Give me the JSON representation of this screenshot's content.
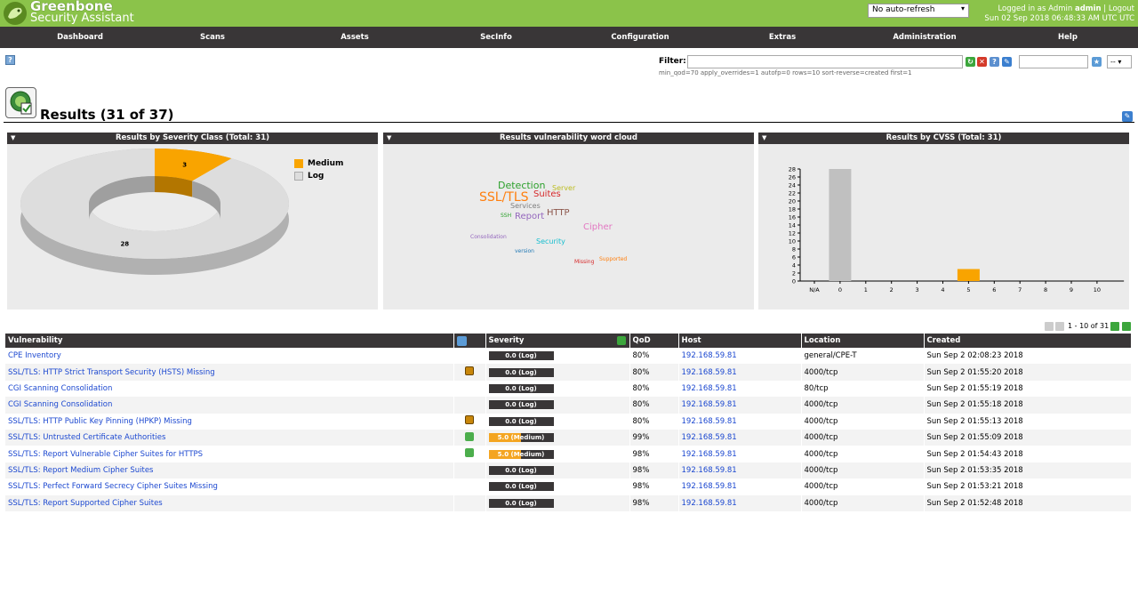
{
  "app": {
    "title": "Greenbone",
    "subtitle": "Security Assistant",
    "refresh": "No auto-refresh",
    "login_prefix": "Logged in as",
    "login_role": "Admin",
    "login_user": "admin",
    "logout": "Logout",
    "datetime": "Sun 02 Sep 2018 06:48:33 AM UTC UTC"
  },
  "menu": [
    "Dashboard",
    "Scans",
    "Assets",
    "SecInfo",
    "Configuration",
    "Extras",
    "Administration",
    "Help"
  ],
  "filter": {
    "label": "Filter:",
    "value": "",
    "text": "min_qod=70 apply_overrides=1 autofp=0 rows=10 sort-reverse=created first=1",
    "select_value": "--"
  },
  "page": {
    "title": "Results (31 of 37)"
  },
  "panels": {
    "severity": {
      "title": "Results by Severity Class (Total: 31)",
      "legend": [
        {
          "label": "Medium",
          "color": "#f9a400"
        },
        {
          "label": "Log",
          "color": "#dddddd"
        }
      ],
      "chart_data": {
        "type": "pie",
        "categories": [
          "Medium",
          "Log"
        ],
        "values": [
          3,
          28
        ],
        "colors": [
          "#f9a400",
          "#dddddd"
        ],
        "title": "Results by Severity Class (Total: 31)"
      }
    },
    "cloud": {
      "title": "Results vulnerability word cloud",
      "words": [
        {
          "text": "Detection",
          "color": "#2ca02c",
          "size": 11
        },
        {
          "text": "Server",
          "color": "#bcbd22",
          "size": 8
        },
        {
          "text": "SSL/TLS",
          "color": "#ff7f0e",
          "size": 14
        },
        {
          "text": "Suites",
          "color": "#d62728",
          "size": 10
        },
        {
          "text": "Services",
          "color": "#7f7f7f",
          "size": 8
        },
        {
          "text": "SSH",
          "color": "#2ca02c",
          "size": 6
        },
        {
          "text": "Report",
          "color": "#9467bd",
          "size": 10
        },
        {
          "text": "HTTP",
          "color": "#8c564b",
          "size": 10
        },
        {
          "text": "Cipher",
          "color": "#e377c2",
          "size": 10
        },
        {
          "text": "Consolidation",
          "color": "#9467bd",
          "size": 6
        },
        {
          "text": "Security",
          "color": "#17becf",
          "size": 8
        },
        {
          "text": "version",
          "color": "#1f77b4",
          "size": 6
        },
        {
          "text": "Missing",
          "color": "#d62728",
          "size": 6
        },
        {
          "text": "Supported",
          "color": "#ff7f0e",
          "size": 6
        }
      ]
    },
    "cvss": {
      "title": "Results by CVSS (Total: 31)",
      "chart_data": {
        "type": "bar",
        "categories": [
          "N/A",
          "0",
          "1",
          "2",
          "3",
          "4",
          "5",
          "6",
          "7",
          "8",
          "9",
          "10"
        ],
        "values": [
          0,
          28,
          0,
          0,
          0,
          0,
          3,
          0,
          0,
          0,
          0,
          0
        ],
        "colors": [
          "#c0c0c0",
          "#c0c0c0",
          "#c0c0c0",
          "#c0c0c0",
          "#c0c0c0",
          "#c0c0c0",
          "#f9a400",
          "#f9a400",
          "#f9a400",
          "#f9a400",
          "#f9a400",
          "#f9a400"
        ],
        "ylim": [
          0,
          28
        ],
        "yticks": [
          0,
          2,
          4,
          6,
          8,
          10,
          12,
          14,
          16,
          18,
          20,
          22,
          24,
          26,
          28
        ],
        "title": "Results by CVSS (Total: 31)"
      }
    }
  },
  "pagination": {
    "text": "1 - 10 of 31"
  },
  "table": {
    "columns": [
      "Vulnerability",
      "",
      "Severity",
      "QoD",
      "Host",
      "Location",
      "Created"
    ],
    "rows": [
      {
        "vuln": "CPE Inventory",
        "icon": "",
        "sev_text": "0.0 (Log)",
        "sev": 0.0,
        "qod": "80%",
        "host": "192.168.59.81",
        "location": "general/CPE-T",
        "created": "Sun Sep 2 02:08:23 2018"
      },
      {
        "vuln": "SSL/TLS: HTTP Strict Transport Security (HSTS) Missing",
        "icon": "note",
        "sev_text": "0.0 (Log)",
        "sev": 0.0,
        "qod": "80%",
        "host": "192.168.59.81",
        "location": "4000/tcp",
        "created": "Sun Sep 2 01:55:20 2018"
      },
      {
        "vuln": "CGI Scanning Consolidation",
        "icon": "",
        "sev_text": "0.0 (Log)",
        "sev": 0.0,
        "qod": "80%",
        "host": "192.168.59.81",
        "location": "80/tcp",
        "created": "Sun Sep 2 01:55:19 2018"
      },
      {
        "vuln": "CGI Scanning Consolidation",
        "icon": "",
        "sev_text": "0.0 (Log)",
        "sev": 0.0,
        "qod": "80%",
        "host": "192.168.59.81",
        "location": "4000/tcp",
        "created": "Sun Sep 2 01:55:18 2018"
      },
      {
        "vuln": "SSL/TLS: HTTP Public Key Pinning (HPKP) Missing",
        "icon": "note",
        "sev_text": "0.0 (Log)",
        "sev": 0.0,
        "qod": "80%",
        "host": "192.168.59.81",
        "location": "4000/tcp",
        "created": "Sun Sep 2 01:55:13 2018"
      },
      {
        "vuln": "SSL/TLS: Untrusted Certificate Authorities",
        "icon": "solution",
        "sev_text": "5.0 (Medium)",
        "sev": 5.0,
        "qod": "99%",
        "host": "192.168.59.81",
        "location": "4000/tcp",
        "created": "Sun Sep 2 01:55:09 2018"
      },
      {
        "vuln": "SSL/TLS: Report Vulnerable Cipher Suites for HTTPS",
        "icon": "solution",
        "sev_text": "5.0 (Medium)",
        "sev": 5.0,
        "qod": "98%",
        "host": "192.168.59.81",
        "location": "4000/tcp",
        "created": "Sun Sep 2 01:54:43 2018"
      },
      {
        "vuln": "SSL/TLS: Report Medium Cipher Suites",
        "icon": "",
        "sev_text": "0.0 (Log)",
        "sev": 0.0,
        "qod": "98%",
        "host": "192.168.59.81",
        "location": "4000/tcp",
        "created": "Sun Sep 2 01:53:35 2018"
      },
      {
        "vuln": "SSL/TLS: Perfect Forward Secrecy Cipher Suites Missing",
        "icon": "",
        "sev_text": "0.0 (Log)",
        "sev": 0.0,
        "qod": "98%",
        "host": "192.168.59.81",
        "location": "4000/tcp",
        "created": "Sun Sep 2 01:53:21 2018"
      },
      {
        "vuln": "SSL/TLS: Report Supported Cipher Suites",
        "icon": "",
        "sev_text": "0.0 (Log)",
        "sev": 0.0,
        "qod": "98%",
        "host": "192.168.59.81",
        "location": "4000/tcp",
        "created": "Sun Sep 2 01:52:48 2018"
      }
    ]
  },
  "colors": {
    "header": "#8bc34a",
    "menu": "#393637",
    "medium": "#f9a400",
    "log": "#dddddd",
    "link": "#1c48d0"
  }
}
